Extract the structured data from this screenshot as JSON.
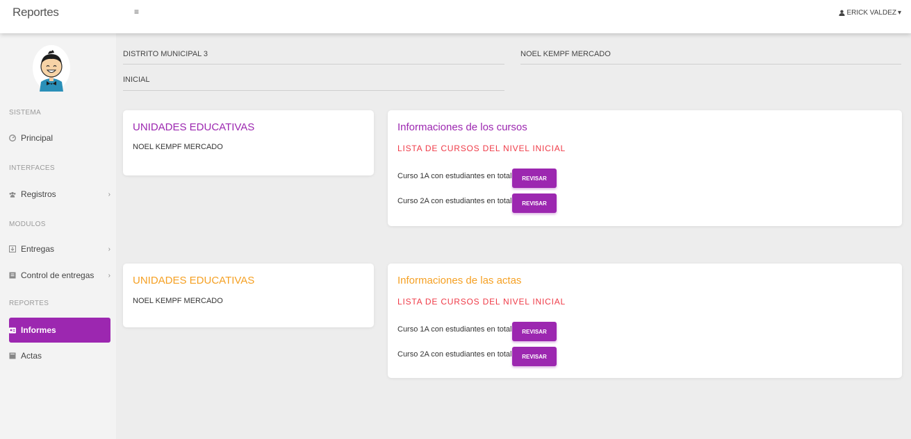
{
  "header": {
    "brand": "Reportes",
    "menu_icon": "≡",
    "user_name": "ERICK VALDEZ",
    "user_caret": "▾"
  },
  "sidebar": {
    "sections": [
      "SISTEMA",
      "INTERFACES",
      "MODULOS",
      "REPORTES"
    ],
    "items": [
      {
        "label": "Principal",
        "icon": "dashboard-icon"
      },
      {
        "label": "Registros",
        "icon": "users-icon",
        "chevron": "›"
      },
      {
        "label": "Entregas",
        "icon": "download-icon",
        "chevron": "›"
      },
      {
        "label": "Control de entregas",
        "icon": "clipboard-icon",
        "chevron": "›"
      },
      {
        "label": "Informes",
        "icon": "id-card-icon",
        "active": true
      },
      {
        "label": "Actas",
        "icon": "book-icon"
      }
    ]
  },
  "info": {
    "district": "DISTRITO MUNICIPAL 3",
    "level": "INICIAL",
    "school": "NOEL KEMPF MERCADO"
  },
  "sections": [
    {
      "left_card": {
        "title": "UNIDADES EDUCATIVAS",
        "name": "NOEL KEMPF MERCADO"
      },
      "right_card": {
        "title": "Informaciones de los cursos",
        "list_heading": "LISTA DE CURSOS DEL NIVEL INICIAL",
        "rows": [
          {
            "text": "Curso 1A con estudiantes en total 24",
            "button": "REVISAR"
          },
          {
            "text": "Curso 2A con estudiantes en total 27",
            "button": "REVISAR"
          }
        ]
      }
    },
    {
      "left_card": {
        "title": "UNIDADES EDUCATIVAS",
        "name": "NOEL KEMPF MERCADO"
      },
      "right_card": {
        "title": "Informaciones de las actas",
        "list_heading": "LISTA DE CURSOS DEL NIVEL INICIAL",
        "rows": [
          {
            "text": "Curso 1A con estudiantes en total 24",
            "button": "REVISAR"
          },
          {
            "text": "Curso 2A con estudiantes en total 27",
            "button": "REVISAR"
          }
        ]
      }
    }
  ],
  "colors": {
    "accent": "#9c27b0",
    "orange": "#f5a023",
    "red": "#ef3a47"
  }
}
